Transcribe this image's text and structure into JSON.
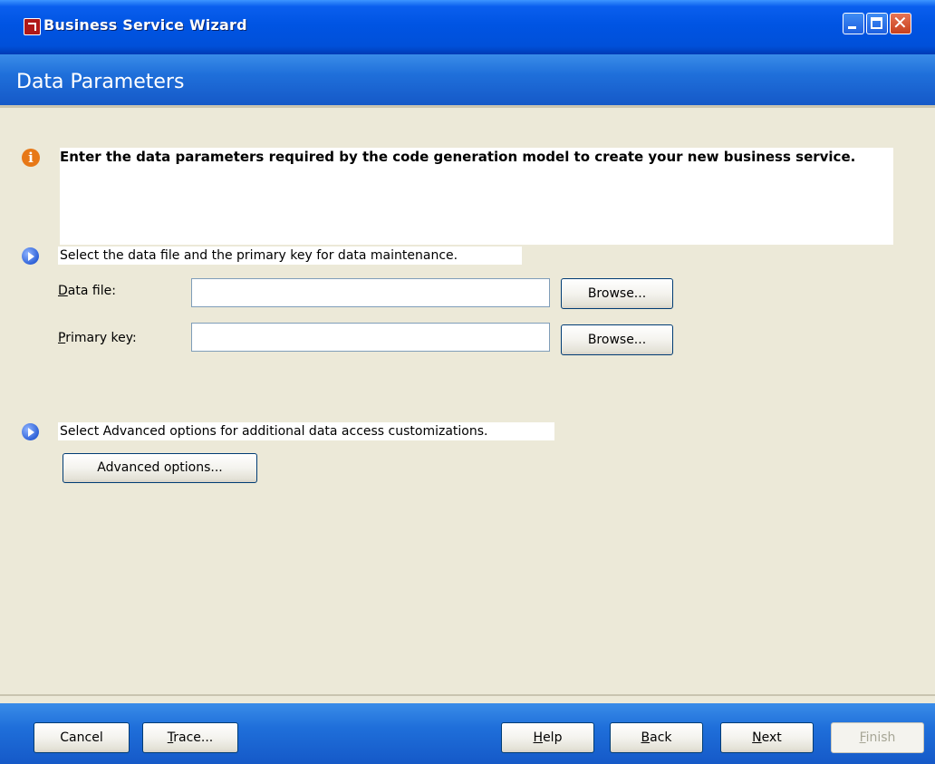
{
  "window": {
    "title": "Business Service Wizard",
    "controls": {
      "minimize": "_",
      "maximize": "□",
      "close": "✕"
    }
  },
  "header": {
    "title": "Data Parameters"
  },
  "info": {
    "text": "Enter the data parameters required by the code generation model to create your new business service."
  },
  "step1": {
    "text": "Select the data file and the primary key for data maintenance.",
    "data_file": {
      "label_first": "D",
      "label_rest": "ata file:",
      "value": "",
      "browse": "Browse..."
    },
    "primary_key": {
      "label_first": "P",
      "label_rest": "rimary key:",
      "value": "",
      "browse": "Browse..."
    }
  },
  "step2": {
    "text": "Select Advanced options for additional data access customizations.",
    "button": "Advanced options..."
  },
  "footer": {
    "cancel": "Cancel",
    "trace_first": "T",
    "trace_rest": "race...",
    "help_first": "H",
    "help_rest": "elp",
    "back_first": "B",
    "back_rest": "ack",
    "next_first": "N",
    "next_rest": "ext",
    "finish_first": "F",
    "finish_rest": "inish"
  },
  "icons": {
    "info": "info-icon",
    "step": "arrow-right-icon",
    "app": "app-icon"
  },
  "colors": {
    "titlebar": "#0054E3",
    "header_band": "#1F6FDA",
    "face": "#ECE9D8",
    "info_icon": "#E77817"
  }
}
